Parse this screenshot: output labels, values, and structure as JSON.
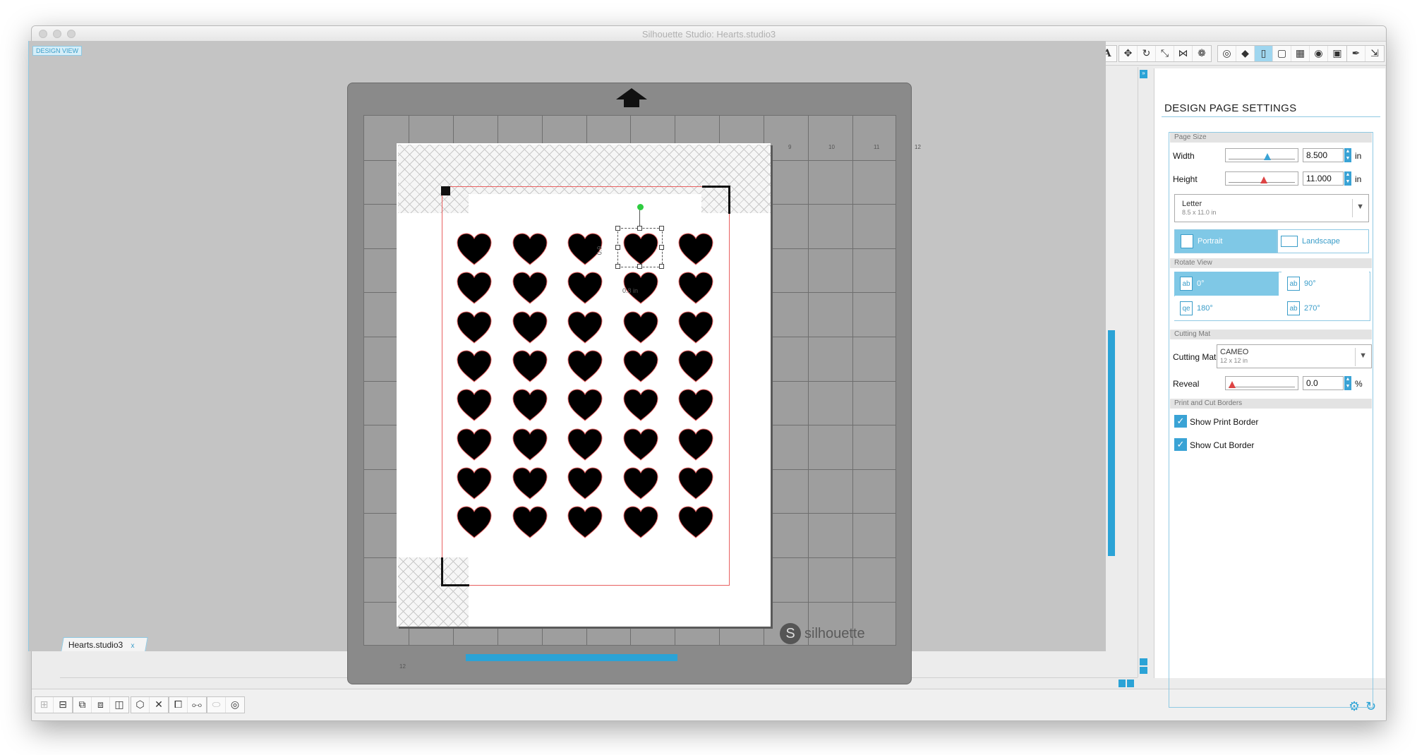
{
  "window": {
    "title": "Silhouette Studio: Hearts.studio3"
  },
  "canvas": {
    "view_label": "DESIGN VIEW",
    "document_tab": "Hearts.studio3",
    "tab_close": "x",
    "watermark": "silhouette"
  },
  "ruler": {
    "top_ticks": [
      "9",
      "10",
      "11",
      "12"
    ],
    "left_tick": "12"
  },
  "selection": {
    "dim_left": "0.9",
    "dim_bottom": "0.8 in"
  },
  "panel": {
    "title": "DESIGN PAGE SETTINGS",
    "page_size": {
      "section": "Page Size",
      "width_label": "Width",
      "width_value": "8.500",
      "width_unit": "in",
      "width_slider": 0.55,
      "height_label": "Height",
      "height_value": "11.000",
      "height_unit": "in",
      "height_slider": 0.5,
      "preset_name": "Letter",
      "preset_size": "8.5 x 11.0 in",
      "orientation": [
        {
          "label": "Portrait",
          "active": true
        },
        {
          "label": "Landscape",
          "active": false
        }
      ]
    },
    "rotate_view": {
      "section": "Rotate View",
      "options": [
        {
          "label": "0°",
          "icon": "ab",
          "active": true
        },
        {
          "label": "90°",
          "icon": "ab",
          "active": false
        },
        {
          "label": "180°",
          "icon": "qe",
          "active": false
        },
        {
          "label": "270°",
          "icon": "ab",
          "active": false
        }
      ]
    },
    "cutting_mat": {
      "section": "Cutting Mat",
      "label": "Cutting Mat",
      "value": "CAMEO",
      "value_sub": "12 x 12 in",
      "reveal_label": "Reveal",
      "reveal_value": "0.0",
      "reveal_unit": "%",
      "reveal_slider": 0.0
    },
    "borders": {
      "section": "Print and Cut Borders",
      "show_print_border": "Show Print Border",
      "show_cut_border": "Show Cut Border",
      "print_checked": true,
      "cut_checked": true
    }
  },
  "colors": {
    "accent": "#3aa3d5",
    "cut_line": "#e86060",
    "heart": "#000000"
  },
  "grid": {
    "rows": 8,
    "cols": 5
  }
}
